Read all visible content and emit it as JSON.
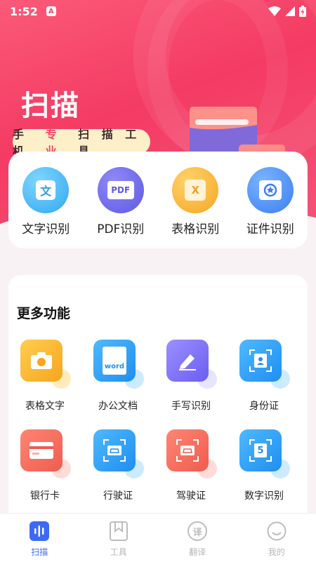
{
  "status_bar": {
    "time": "1:52",
    "notif_glyph": "A"
  },
  "hero": {
    "title": "扫描",
    "slogan_pre": "手 机 ",
    "slogan_highlight": "专 业",
    "slogan_post": " 扫 描 工 具"
  },
  "quick_actions": [
    {
      "label": "文字识别",
      "icon": "text-recognition-icon",
      "glyph": "文"
    },
    {
      "label": "PDF识别",
      "icon": "pdf-icon",
      "glyph": "PDF"
    },
    {
      "label": "表格识别",
      "icon": "excel-table-icon",
      "glyph": "X"
    },
    {
      "label": "证件识别",
      "icon": "id-card-icon",
      "glyph": ""
    }
  ],
  "more": {
    "title": "更多功能",
    "items": [
      {
        "label": "表格文字",
        "icon": "camera-icon"
      },
      {
        "label": "办公文档",
        "icon": "word-document-icon",
        "glyph": "word"
      },
      {
        "label": "手写识别",
        "icon": "handwriting-pen-icon"
      },
      {
        "label": "身份证",
        "icon": "id-portrait-icon"
      },
      {
        "label": "银行卡",
        "icon": "bank-card-icon"
      },
      {
        "label": "行驶证",
        "icon": "vehicle-license-icon"
      },
      {
        "label": "驾驶证",
        "icon": "driver-license-icon"
      },
      {
        "label": "数字识别",
        "icon": "number-recognition-icon",
        "glyph": "5"
      }
    ]
  },
  "nav": [
    {
      "label": "扫描",
      "icon": "scan-icon",
      "active": true
    },
    {
      "label": "工具",
      "icon": "tools-bookmark-icon",
      "active": false
    },
    {
      "label": "翻译",
      "icon": "translate-icon",
      "glyph": "译",
      "active": false
    },
    {
      "label": "我的",
      "icon": "profile-smile-icon",
      "active": false
    }
  ],
  "colors": {
    "brand": "#f43b63",
    "nav_active": "#3d6af5",
    "slogan_bg": "#fdefc8"
  }
}
